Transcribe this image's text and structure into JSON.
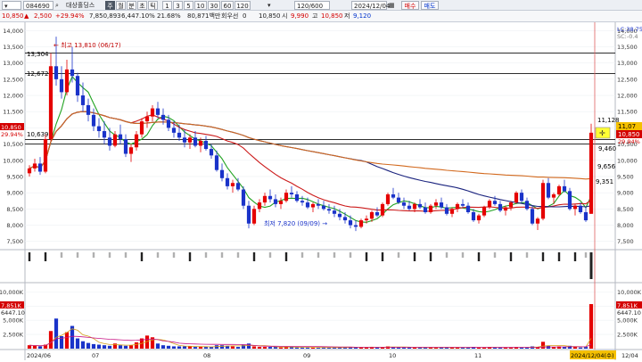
{
  "toolbar": {
    "code": "084690",
    "stock_name": "대상홀딩스",
    "mode_tabs": [
      "주",
      "월",
      "분",
      "초",
      "틱"
    ],
    "active_mode": 0,
    "intervals": [
      "1",
      "3",
      "5",
      "10",
      "30",
      "60",
      "120"
    ],
    "period": "120/600",
    "date": "2024/12/04",
    "toggle_labels": [
      "매수",
      "매도"
    ]
  },
  "quote": {
    "price": "10,850",
    "change": "2,500",
    "change_pct": "+29.94%",
    "volume": "7,850,893",
    "volume_pct": "6,447.10%",
    "turnover": "21.68%",
    "amount": "80,871백만",
    "ex_label": "회우선",
    "ex_value": "0",
    "open": "10,850",
    "high_label": "시",
    "high": "9,990",
    "low_label": "고",
    "low": "10,850",
    "close_label": "저",
    "close": "9,120"
  },
  "price_axis": {
    "ticks": [
      "14,000",
      "13,500",
      "13,000",
      "12,500",
      "12,000",
      "11,500",
      "11,000",
      "10,500",
      "10,000",
      "9,500",
      "9,000",
      "8,500",
      "8,000",
      "7,500"
    ],
    "current_tag": "11,07",
    "price_tag": "10,850",
    "pct_tag": "29.94%",
    "ref_tag": "10,500",
    "lc_label": "LC:38.75",
    "lc_sub": "SC:-0.4"
  },
  "annotations": {
    "high_label": "← 최고 13,810 (06/17)",
    "low_label": "최저 7,820 (09/09) →",
    "hline_labels": [
      "13,304",
      "12,672",
      "10,639"
    ],
    "last_high": "11,128",
    "last_low": "9,460",
    "level_9656": "9,656",
    "level_9351": "9,351"
  },
  "volume_axis": {
    "ticks": [
      "10,000K",
      "7,500K",
      "5,000K",
      "2,500K"
    ],
    "left_ticks": [
      "10,000K",
      "7,500K",
      "5,000K",
      "2,500K"
    ],
    "tag1": "7,851K",
    "tag2": "6447.10"
  },
  "date_axis": {
    "labels": [
      "2024/06",
      "07",
      "08",
      "09",
      "10",
      "11",
      "2024/12/04(수)",
      "12/04"
    ]
  },
  "colors": {
    "up": "#e50000",
    "down": "#1a33c9",
    "ma5": "#21a321",
    "ma20": "#cc1a1a",
    "ma60": "#1a237e",
    "ma120": "#d2691e"
  },
  "chart_data": {
    "type": "candlestick",
    "ylim": [
      7300,
      14200
    ],
    "candles": [
      [
        9600,
        9850,
        9500,
        9750
      ],
      [
        9750,
        10050,
        9650,
        9900
      ],
      [
        9900,
        10100,
        9550,
        9650
      ],
      [
        9650,
        10800,
        9600,
        10650
      ],
      [
        10650,
        13304,
        10600,
        12900
      ],
      [
        12900,
        13810,
        12300,
        12500
      ],
      [
        12500,
        12900,
        11900,
        12100
      ],
      [
        12100,
        13100,
        12000,
        12800
      ],
      [
        12800,
        13500,
        12400,
        12600
      ],
      [
        12600,
        12700,
        11800,
        12000
      ],
      [
        12000,
        12400,
        11500,
        11700
      ],
      [
        11700,
        11900,
        11200,
        11400
      ],
      [
        11400,
        11600,
        10900,
        11050
      ],
      [
        11050,
        11300,
        10700,
        10900
      ],
      [
        10900,
        11200,
        10500,
        10700
      ],
      [
        10700,
        11000,
        10300,
        10450
      ],
      [
        10450,
        10900,
        10400,
        10800
      ],
      [
        10800,
        11100,
        10500,
        10650
      ],
      [
        10650,
        10800,
        10100,
        10200
      ],
      [
        10200,
        10500,
        9950,
        10400
      ],
      [
        10400,
        10900,
        10300,
        10800
      ],
      [
        10800,
        11300,
        10700,
        11200
      ],
      [
        11200,
        11500,
        11000,
        11350
      ],
      [
        11350,
        11700,
        11200,
        11600
      ],
      [
        11600,
        11800,
        11300,
        11400
      ],
      [
        11400,
        11600,
        11100,
        11250
      ],
      [
        11250,
        11400,
        10900,
        11000
      ],
      [
        11000,
        11200,
        10700,
        10850
      ],
      [
        10850,
        11100,
        10600,
        10700
      ],
      [
        10700,
        10950,
        10400,
        10550
      ],
      [
        10550,
        10800,
        10350,
        10700
      ],
      [
        10700,
        10900,
        10400,
        10450
      ],
      [
        10450,
        10700,
        10250,
        10600
      ],
      [
        10600,
        10750,
        10300,
        10350
      ],
      [
        10350,
        10500,
        10050,
        10150
      ],
      [
        10150,
        10300,
        9650,
        9700
      ],
      [
        9700,
        9900,
        9350,
        9450
      ],
      [
        9450,
        9600,
        9100,
        9200
      ],
      [
        9200,
        9400,
        9000,
        9300
      ],
      [
        9300,
        9450,
        9050,
        9100
      ],
      [
        9100,
        9200,
        8500,
        8600
      ],
      [
        8600,
        8750,
        7900,
        8050
      ],
      [
        8050,
        8600,
        8000,
        8500
      ],
      [
        8500,
        8800,
        8400,
        8700
      ],
      [
        8700,
        9000,
        8600,
        8900
      ],
      [
        8900,
        9100,
        8700,
        8800
      ],
      [
        8800,
        8950,
        8550,
        8650
      ],
      [
        8650,
        8850,
        8500,
        8750
      ],
      [
        8750,
        9100,
        8700,
        9000
      ],
      [
        9000,
        9200,
        8850,
        8950
      ],
      [
        8950,
        9050,
        8700,
        8750
      ],
      [
        8750,
        8900,
        8600,
        8700
      ],
      [
        8700,
        8850,
        8500,
        8550
      ],
      [
        8550,
        8700,
        8400,
        8650
      ],
      [
        8650,
        8800,
        8500,
        8600
      ],
      [
        8600,
        8750,
        8450,
        8500
      ],
      [
        8500,
        8650,
        8350,
        8450
      ],
      [
        8450,
        8600,
        8250,
        8350
      ],
      [
        8350,
        8500,
        8150,
        8250
      ],
      [
        8250,
        8400,
        8050,
        8150
      ],
      [
        8150,
        8300,
        7900,
        8000
      ],
      [
        8000,
        8150,
        7820,
        7950
      ],
      [
        7950,
        8200,
        7900,
        8150
      ],
      [
        8150,
        8300,
        8050,
        8200
      ],
      [
        8200,
        8450,
        8100,
        8400
      ],
      [
        8400,
        8550,
        8250,
        8300
      ],
      [
        8300,
        8700,
        8250,
        8650
      ],
      [
        8650,
        9000,
        8600,
        8950
      ],
      [
        8950,
        9150,
        8800,
        8850
      ],
      [
        8850,
        9000,
        8650,
        8700
      ],
      [
        8700,
        8850,
        8500,
        8600
      ],
      [
        8600,
        8750,
        8450,
        8500
      ],
      [
        8500,
        8700,
        8400,
        8650
      ],
      [
        8650,
        8800,
        8500,
        8550
      ],
      [
        8550,
        8700,
        8350,
        8400
      ],
      [
        8400,
        8650,
        8350,
        8600
      ],
      [
        8600,
        8800,
        8500,
        8700
      ],
      [
        8700,
        8850,
        8500,
        8550
      ],
      [
        8550,
        8650,
        8300,
        8350
      ],
      [
        8350,
        8550,
        8250,
        8500
      ],
      [
        8500,
        8700,
        8400,
        8650
      ],
      [
        8650,
        8800,
        8550,
        8600
      ],
      [
        8600,
        8700,
        8350,
        8400
      ],
      [
        8400,
        8500,
        8100,
        8150
      ],
      [
        8150,
        8350,
        8050,
        8300
      ],
      [
        8300,
        8600,
        8250,
        8550
      ],
      [
        8550,
        8800,
        8500,
        8750
      ],
      [
        8750,
        8900,
        8600,
        8650
      ],
      [
        8650,
        8750,
        8400,
        8450
      ],
      [
        8450,
        8600,
        8300,
        8550
      ],
      [
        8550,
        8750,
        8450,
        8700
      ],
      [
        8700,
        9050,
        8650,
        9000
      ],
      [
        9000,
        9100,
        8700,
        8750
      ],
      [
        8750,
        8850,
        8450,
        8500
      ],
      [
        8500,
        8600,
        8000,
        8050
      ],
      [
        8050,
        8250,
        7850,
        8200
      ],
      [
        8200,
        9400,
        8150,
        9300
      ],
      [
        9300,
        9450,
        8800,
        8850
      ],
      [
        8850,
        9000,
        8650,
        8950
      ],
      [
        8950,
        9250,
        8900,
        9200
      ],
      [
        9200,
        9400,
        9000,
        9050
      ],
      [
        9050,
        9150,
        8450,
        8500
      ],
      [
        8500,
        8650,
        8300,
        8600
      ],
      [
        8600,
        8700,
        8350,
        8400
      ],
      [
        8400,
        8550,
        8100,
        8150
      ],
      [
        8350,
        11128,
        8350,
        10850
      ]
    ],
    "volumes": [
      0.6,
      0.5,
      0.4,
      0.7,
      3.1,
      5.3,
      2.2,
      2.9,
      4.0,
      1.8,
      1.3,
      1.0,
      0.8,
      0.7,
      0.6,
      0.5,
      0.9,
      0.6,
      0.5,
      0.6,
      1.1,
      1.8,
      2.3,
      2.0,
      0.9,
      0.6,
      0.5,
      0.4,
      0.4,
      0.4,
      0.4,
      0.3,
      0.3,
      0.3,
      0.3,
      0.6,
      0.6,
      0.5,
      0.4,
      0.3,
      0.7,
      0.9,
      0.4,
      0.3,
      0.3,
      0.3,
      0.3,
      0.2,
      0.3,
      0.3,
      0.2,
      0.2,
      0.2,
      0.2,
      0.2,
      0.2,
      0.2,
      0.2,
      0.2,
      0.2,
      0.3,
      0.3,
      0.2,
      0.2,
      0.3,
      0.2,
      0.3,
      0.4,
      0.3,
      0.2,
      0.2,
      0.2,
      0.2,
      0.2,
      0.2,
      0.2,
      0.2,
      0.2,
      0.2,
      0.2,
      0.2,
      0.2,
      0.2,
      0.3,
      0.2,
      0.2,
      0.3,
      0.2,
      0.2,
      0.2,
      0.2,
      0.3,
      0.2,
      0.2,
      0.4,
      0.3,
      1.2,
      0.5,
      0.3,
      0.4,
      0.3,
      0.5,
      0.3,
      0.2,
      0.3,
      7.85
    ],
    "hlines": [
      13304,
      12672,
      10639
    ],
    "volume_max": 11000
  }
}
